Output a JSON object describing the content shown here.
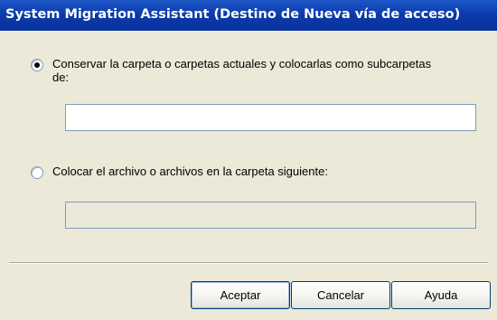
{
  "window": {
    "title": "System Migration Assistant (Destino de Nueva vía de acceso)"
  },
  "options": {
    "keep_folders_label": "Conservar la carpeta o carpetas actuales y colocarlas como subcarpetas de:",
    "keep_folders_selected": true,
    "keep_folders_path_value": "",
    "place_files_label": "Colocar el archivo o archivos en la carpeta siguiente:",
    "place_files_selected": false,
    "place_files_path_value": ""
  },
  "buttons": {
    "accept_label": "Aceptar",
    "cancel_label": "Cancelar",
    "help_label": "Ayuda"
  }
}
